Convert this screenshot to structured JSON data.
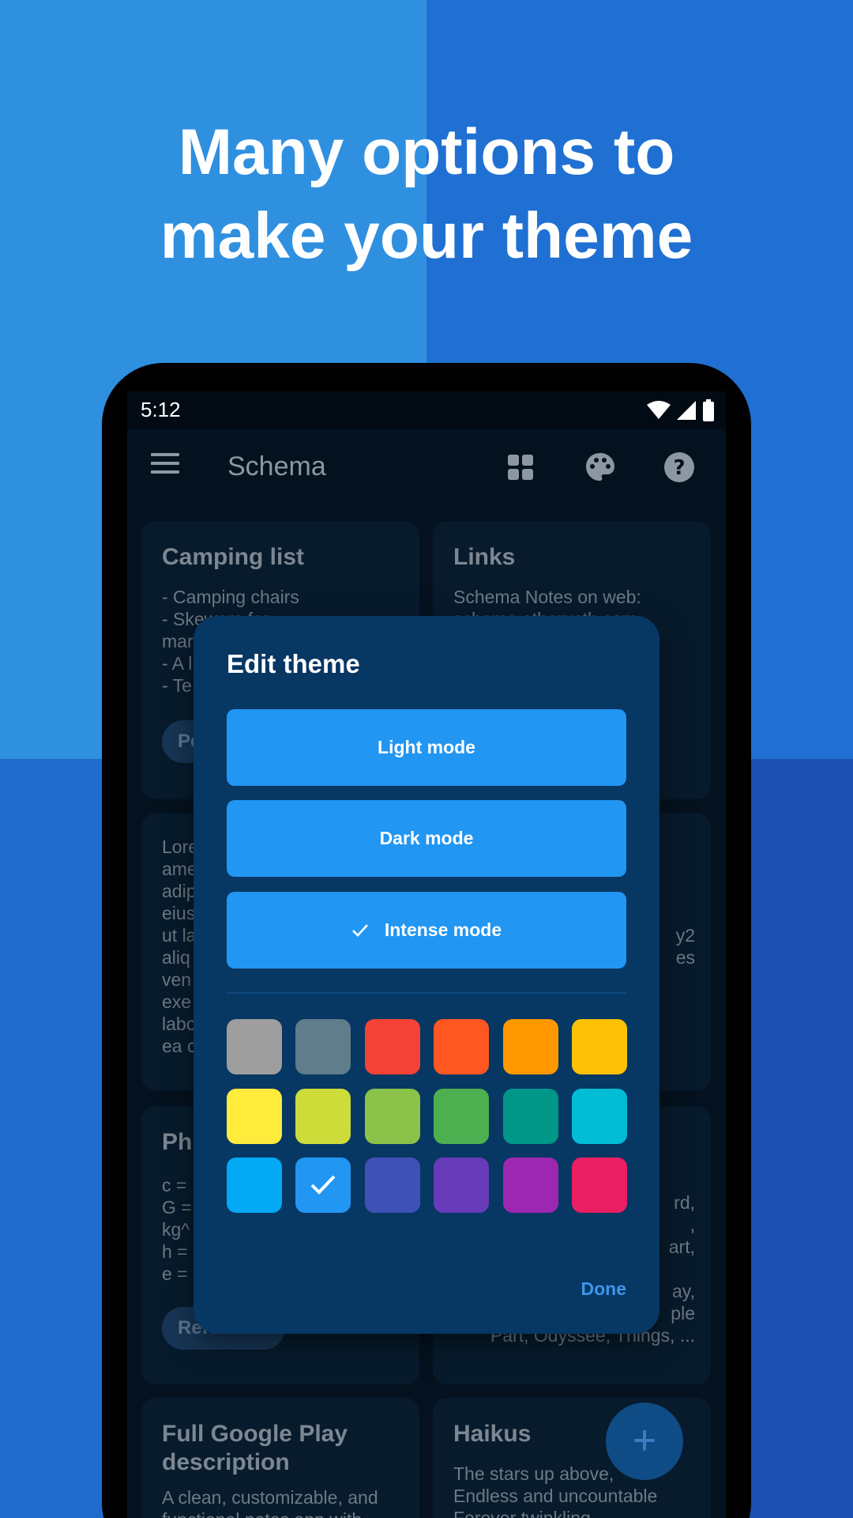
{
  "headline": {
    "line1": "Many options to",
    "line2": "make your theme"
  },
  "status_bar": {
    "time": "5:12",
    "icons": [
      "wifi-icon",
      "signal-icon",
      "battery-icon"
    ]
  },
  "app_bar": {
    "title": "Schema",
    "actions": [
      "grid-view-icon",
      "palette-icon",
      "help-icon"
    ]
  },
  "notes": [
    {
      "title": "Camping list",
      "body": "- Camping chairs\n- Skewers for\nmar\n- A l\n- Te",
      "chip": "Pe"
    },
    {
      "title": "Links",
      "body": "Schema Notes on web:\nschema.etherusth.com"
    },
    {
      "title": "",
      "body": "Lore\name\nadip\neius\nut la\naliq\nven\nexe\nlabo\nea c"
    },
    {
      "title": "",
      "body": "\n\n\n\ny2\nes"
    },
    {
      "title": "Ph",
      "body": "c =\nG =\nkg^\nh =\ne =",
      "chip": "Reference"
    },
    {
      "title": "",
      "body": "rd,\n,\nart,\n\nay,\nple\nPart, Odyssee, Things, ..."
    },
    {
      "title": "Full Google Play\ndescription",
      "body": "A clean, customizable, and\nfunctional notes app with"
    },
    {
      "title": "Haikus",
      "body": "The stars up above,\nEndless and uncountable\nForever twinkling"
    }
  ],
  "fab": {
    "label": "+"
  },
  "dialog": {
    "title": "Edit theme",
    "modes": [
      {
        "label": "Light mode",
        "selected": false
      },
      {
        "label": "Dark mode",
        "selected": false
      },
      {
        "label": "Intense mode",
        "selected": true
      }
    ],
    "selected_mark": "✓",
    "colors": [
      [
        "#9e9e9e",
        "#607d8b",
        "#f44336",
        "#ff5722",
        "#ff9800",
        "#ffc107"
      ],
      [
        "#ffeb3b",
        "#cddc39",
        "#8bc34a",
        "#4caf50",
        "#009688",
        "#00bcd4"
      ],
      [
        "#03a9f4",
        "#2196f3",
        "#3f51b5",
        "#673ab7",
        "#9c27b0",
        "#e91e63"
      ]
    ],
    "selected_color": "#2196f3",
    "done_label": "Done"
  }
}
